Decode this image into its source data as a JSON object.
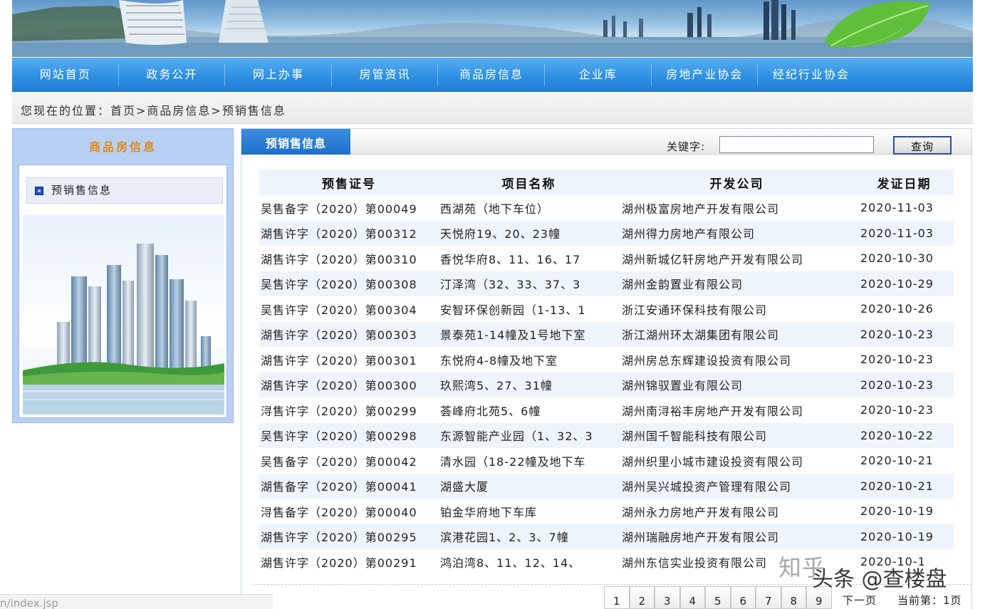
{
  "nav": {
    "items": [
      "网站首页",
      "政务公开",
      "网上办事",
      "房管资讯",
      "商品房信息",
      "企业库",
      "房地产业协会",
      "经纪行业协会"
    ]
  },
  "breadcrumb": "您现在的位置：首页>商品房信息>预销售信息",
  "sidebar": {
    "title": "商品房信息",
    "item": "预销售信息"
  },
  "main": {
    "tab": "预销售信息",
    "keyword_label": "关键字:",
    "keyword_value": "",
    "search_button": "查询",
    "columns": [
      "预售证号",
      "项目名称",
      "开发公司",
      "发证日期"
    ],
    "rows": [
      {
        "cert": "吴售备字（2020）第00049",
        "project": "西湖苑（地下车位）",
        "company": "湖州极富房地产开发有限公司",
        "date": "2020-11-03"
      },
      {
        "cert": "湖售许字（2020）第00312",
        "project": "天悦府19、20、23幢",
        "company": "湖州得力房地产有限公司",
        "date": "2020-11-03"
      },
      {
        "cert": "湖售许字（2020）第00310",
        "project": "香悦华府8、11、16、17",
        "company": "湖州新城亿轩房地产开发有限公司",
        "date": "2020-10-30"
      },
      {
        "cert": "吴售许字（2020）第00308",
        "project": "汀泽湾（32、33、37、3",
        "company": "湖州金韵置业有限公司",
        "date": "2020-10-29"
      },
      {
        "cert": "吴售许字（2020）第00304",
        "project": "安智环保创新园（1-13、1",
        "company": "浙江安通环保科技有限公司",
        "date": "2020-10-26"
      },
      {
        "cert": "湖售许字（2020）第00303",
        "project": "景泰苑1-14幢及1号地下室",
        "company": "浙江湖州环太湖集团有限公司",
        "date": "2020-10-23"
      },
      {
        "cert": "湖售许字（2020）第00301",
        "project": "东悦府4-8幢及地下室",
        "company": "湖州房总东辉建设投资有限公司",
        "date": "2020-10-23"
      },
      {
        "cert": "湖售许字（2020）第00300",
        "project": "玖熙湾5、27、31幢",
        "company": "湖州锦驭置业有限公司",
        "date": "2020-10-23"
      },
      {
        "cert": "浔售许字（2020）第00299",
        "project": "荟峰府北苑5、6幢",
        "company": "湖州南浔裕丰房地产开发有限公司",
        "date": "2020-10-23"
      },
      {
        "cert": "吴售许字（2020）第00298",
        "project": "东源智能产业园（1、32、3",
        "company": "湖州国千智能科技有限公司",
        "date": "2020-10-22"
      },
      {
        "cert": "吴售备字（2020）第00042",
        "project": "清水园（18-22幢及地下车",
        "company": "湖州织里小城市建设投资有限公司",
        "date": "2020-10-21"
      },
      {
        "cert": "湖售备字（2020）第00041",
        "project": "湖盛大厦",
        "company": "湖州吴兴城投资产管理有限公司",
        "date": "2020-10-21"
      },
      {
        "cert": "浔售备字（2020）第00040",
        "project": "铂金华府地下车库",
        "company": "湖州永力房地产开发有限公司",
        "date": "2020-10-19"
      },
      {
        "cert": "湖售许字（2020）第00295",
        "project": "滨港花园1、2、3、7幢",
        "company": "湖州瑞融房地产开发有限公司",
        "date": "2020-10-19"
      },
      {
        "cert": "湖售许字（2020）第00291",
        "project": "鸿泊湾8、11、12、14、",
        "company": "湖州东信实业投资有限公司",
        "date": "2020-10-1"
      }
    ]
  },
  "pager": {
    "pages": [
      "1",
      "2",
      "3",
      "4",
      "5",
      "6",
      "7",
      "8",
      "9"
    ],
    "next": "下一页",
    "current": "当前第：1页"
  },
  "status_url": "n/index.jsp",
  "watermark": {
    "zhihu": "知乎",
    "toutiao": "头条 @查楼盘"
  },
  "colors": {
    "nav_blue": "#2f90e2",
    "sidebar_title": "#e08a1b",
    "tab_blue": "#1f6fc8",
    "row_alt": "#eef4fb"
  }
}
